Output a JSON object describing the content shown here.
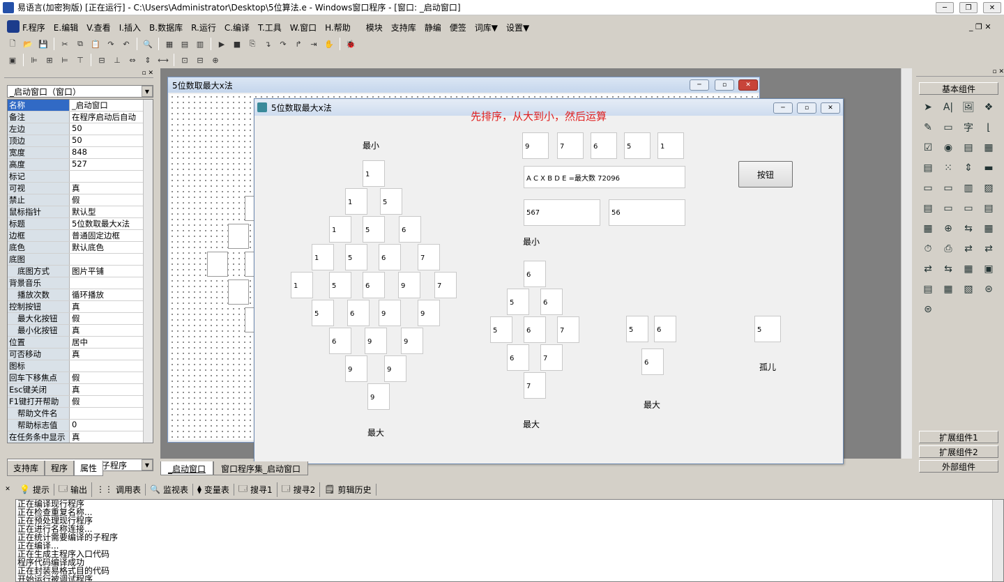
{
  "window": {
    "title": "易语言(加密狗版) [正在运行] - C:\\Users\\Administrator\\Desktop\\5位算法.e - Windows窗口程序 - [窗口: _启动窗口]",
    "controls": [
      "─",
      "❐",
      "✕"
    ]
  },
  "menu": [
    "F.程序",
    "E.编辑",
    "V.查看",
    "I.插入",
    "B.数据库",
    "R.运行",
    "C.编译",
    "T.工具",
    "W.窗口",
    "H.帮助",
    "模块",
    "支持库",
    "静编",
    "便签",
    "词库▼",
    "设置▼"
  ],
  "properties": {
    "object_combo": "_启动窗口（窗口）",
    "rows": [
      {
        "k": "名称",
        "v": "_启动窗口",
        "sub": false,
        "sel": true
      },
      {
        "k": "备注",
        "v": "在程序启动后自动",
        "sub": false
      },
      {
        "k": "左边",
        "v": "50",
        "sub": false
      },
      {
        "k": "顶边",
        "v": "50",
        "sub": false
      },
      {
        "k": "宽度",
        "v": "848",
        "sub": false
      },
      {
        "k": "高度",
        "v": "527",
        "sub": false
      },
      {
        "k": "标记",
        "v": "",
        "sub": false
      },
      {
        "k": "可视",
        "v": "真",
        "sub": false
      },
      {
        "k": "禁止",
        "v": "假",
        "sub": false
      },
      {
        "k": "鼠标指针",
        "v": "默认型",
        "sub": false
      },
      {
        "k": "标题",
        "v": "5位数取最大x法",
        "sub": false
      },
      {
        "k": "边框",
        "v": "普通固定边框",
        "sub": false
      },
      {
        "k": "底色",
        "v": "默认底色",
        "sub": false
      },
      {
        "k": "底图",
        "v": "",
        "sub": false
      },
      {
        "k": "底图方式",
        "v": "图片平铺",
        "sub": true
      },
      {
        "k": "背景音乐",
        "v": "",
        "sub": false
      },
      {
        "k": "播放次数",
        "v": "循环播放",
        "sub": true
      },
      {
        "k": "控制按钮",
        "v": "真",
        "sub": false
      },
      {
        "k": "最大化按钮",
        "v": "假",
        "sub": true
      },
      {
        "k": "最小化按钮",
        "v": "真",
        "sub": true
      },
      {
        "k": "位置",
        "v": "居中",
        "sub": false
      },
      {
        "k": "可否移动",
        "v": "真",
        "sub": false
      },
      {
        "k": "图标",
        "v": "",
        "sub": false
      },
      {
        "k": "回车下移焦点",
        "v": "假",
        "sub": false
      },
      {
        "k": "Esc键关闭",
        "v": "真",
        "sub": false
      },
      {
        "k": "F1键打开帮助",
        "v": "假",
        "sub": false
      },
      {
        "k": "帮助文件名",
        "v": "",
        "sub": true
      },
      {
        "k": "帮助标志值",
        "v": "0",
        "sub": true
      },
      {
        "k": "在任务条中显示",
        "v": "真",
        "sub": false
      }
    ],
    "event_combo": "在此处选择加入事件处理子程序",
    "tabs": [
      "支持库",
      "程序",
      "属性"
    ]
  },
  "designer": {
    "form_title": "5位数取最大x法",
    "doc_tabs": [
      "_启动窗口",
      "窗口程序集_启动窗口"
    ]
  },
  "runwin": {
    "title": "5位数取最大x法",
    "red_note": "先排序，从大到小，然后运算",
    "labels": {
      "min1": "最小",
      "max1": "最大",
      "min2": "最小",
      "max2": "最大",
      "max3": "最大",
      "orphan": "孤儿"
    },
    "top_row": [
      "9",
      "7",
      "6",
      "5",
      "1"
    ],
    "expr": "A C X B D E =最大数 72096",
    "box567": "567",
    "box56": "56",
    "button": "按钮",
    "diamond": [
      "1",
      "1",
      "5",
      "1",
      "5",
      "6",
      "1",
      "5",
      "6",
      "7",
      "1",
      "5",
      "6",
      "9",
      "7",
      "5",
      "6",
      "9",
      "9",
      "6",
      "9",
      "9",
      "9",
      "9",
      "9"
    ],
    "diamond2": [
      "6",
      "5",
      "6",
      "5",
      "6",
      "7",
      "6",
      "7",
      "7"
    ],
    "tri": [
      "5",
      "6",
      "6"
    ],
    "single": "5"
  },
  "right_panel": {
    "top": "基本组件",
    "bottom": [
      "扩展组件1",
      "扩展组件2",
      "外部组件"
    ]
  },
  "output_tabs": [
    "提示",
    "输出",
    "调用表",
    "监视表",
    "变量表",
    "搜寻1",
    "搜寻2",
    "剪辑历史"
  ],
  "output_lines": [
    "正在编译现行程序",
    "正在检查重复名称...",
    "正在预处理现行程序",
    "正在进行名称连接...",
    "正在统计需要编译的子程序",
    "正在编译...",
    "正在生成主程序入口代码",
    "程序代码编译成功",
    "正在封装易格式目的代码",
    "开始运行被调试程序"
  ]
}
